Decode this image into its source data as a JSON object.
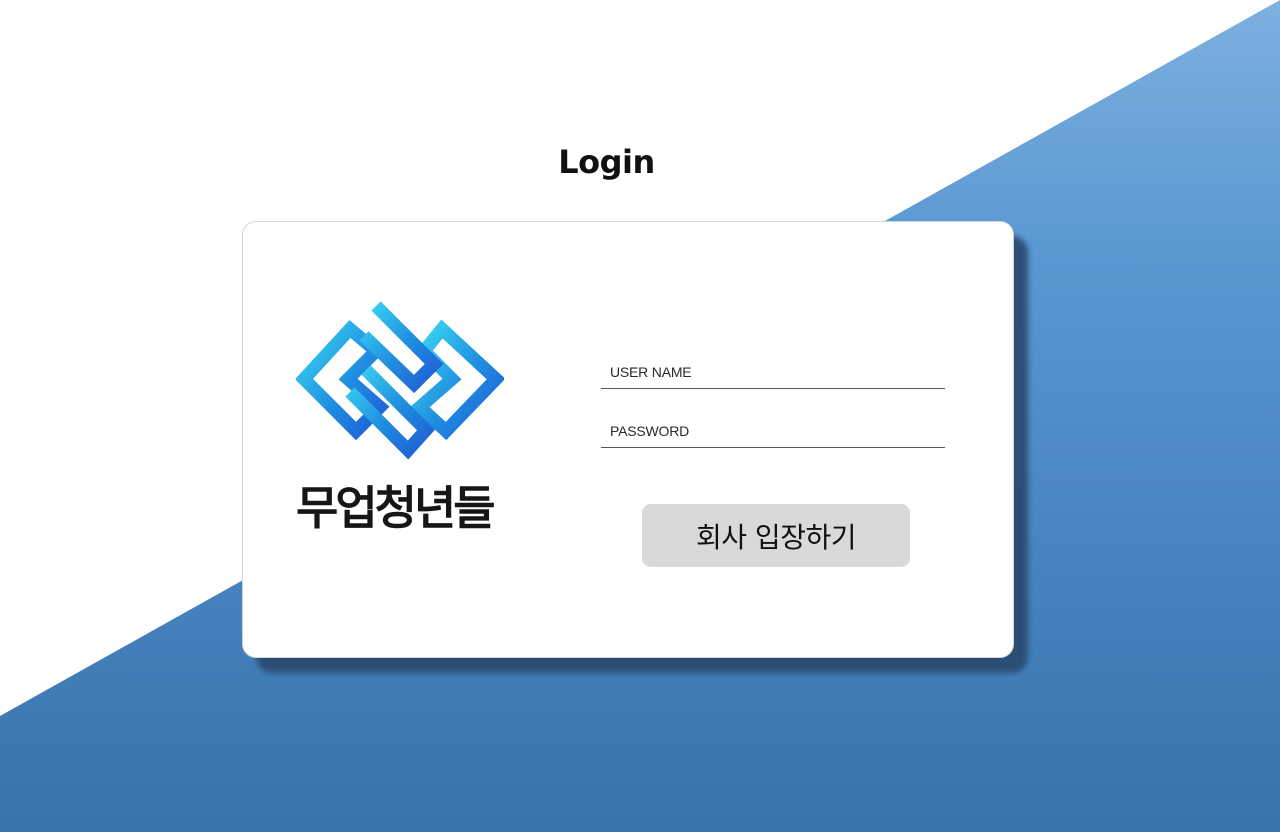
{
  "page": {
    "title": "Login"
  },
  "brand": {
    "name": "무업청년들",
    "logo_icon": "interlocking-diamonds-logo",
    "logo_colors": [
      "#37d0f0",
      "#1f8ee0",
      "#1f5fd6"
    ]
  },
  "form": {
    "username_placeholder": "USER NAME",
    "username_value": "",
    "password_placeholder": "PASSWORD",
    "password_value": "",
    "submit_label": "회사 입장하기"
  },
  "colors": {
    "background_accent": "#4a87c4",
    "card_background": "#ffffff",
    "button_background": "#d9d9d9"
  }
}
